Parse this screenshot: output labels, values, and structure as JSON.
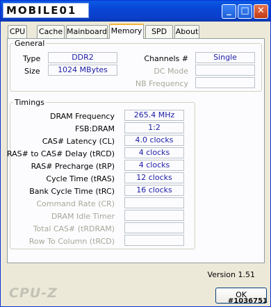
{
  "titlebar": {
    "logo_text": "MOBILE01"
  },
  "tabs": [
    "CPU",
    "Cache",
    "Mainboard",
    "Memory",
    "SPD",
    "About"
  ],
  "active_tab": "Memory",
  "general": {
    "legend": "General",
    "type_label": "Type",
    "type_value": "DDR2",
    "size_label": "Size",
    "size_value": "1024 MBytes",
    "channels_label": "Channels #",
    "channels_value": "Single",
    "dcmode_label": "DC Mode",
    "dcmode_value": "",
    "nbfreq_label": "NB Frequency",
    "nbfreq_value": ""
  },
  "timings": {
    "legend": "Timings",
    "rows": [
      {
        "label": "DRAM Frequency",
        "value": "265.4 MHz",
        "enabled": true
      },
      {
        "label": "FSB:DRAM",
        "value": "1:2",
        "enabled": true
      },
      {
        "label": "CAS# Latency (CL)",
        "value": "4.0 clocks",
        "enabled": true
      },
      {
        "label": "RAS# to CAS# Delay (tRCD)",
        "value": "4 clocks",
        "enabled": true
      },
      {
        "label": "RAS# Precharge (tRP)",
        "value": "4 clocks",
        "enabled": true
      },
      {
        "label": "Cycle Time (tRAS)",
        "value": "12 clocks",
        "enabled": true
      },
      {
        "label": "Bank Cycle Time (tRC)",
        "value": "16 clocks",
        "enabled": true
      },
      {
        "label": "Command Rate (CR)",
        "value": "",
        "enabled": false
      },
      {
        "label": "DRAM Idle Timer",
        "value": "",
        "enabled": false
      },
      {
        "label": "Total CAS# (tRDRAM)",
        "value": "",
        "enabled": false
      },
      {
        "label": "Row To Column (tRCD)",
        "value": "",
        "enabled": false
      }
    ]
  },
  "footer": {
    "version": "Version 1.51",
    "brand": "CPU-Z",
    "ok_label": "OK",
    "watermark": "#1036751"
  },
  "colors": {
    "value_text": "#1a1aa6",
    "disabled_text": "#a7a79a",
    "title_bar": "#0846d6"
  }
}
